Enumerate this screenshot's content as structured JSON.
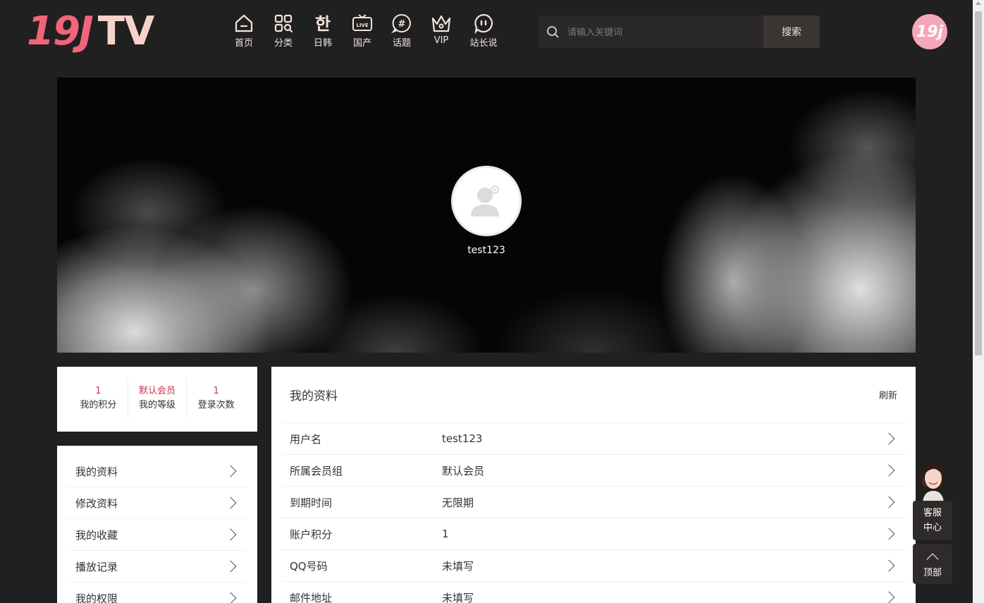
{
  "header": {
    "logo_part1": "19J",
    "logo_part2": "TV",
    "nav": [
      {
        "label": "首页",
        "icon": "home-icon"
      },
      {
        "label": "分类",
        "icon": "category-icon"
      },
      {
        "label": "日韩",
        "icon": "korean-char-icon",
        "glyph": "한"
      },
      {
        "label": "国产",
        "icon": "live-tv-icon",
        "glyph": "LIVE"
      },
      {
        "label": "话题",
        "icon": "hashtag-icon",
        "glyph": "#"
      },
      {
        "label": "VIP",
        "icon": "crown-icon"
      },
      {
        "label": "站长说",
        "icon": "chat-bubble-icon"
      }
    ],
    "search": {
      "placeholder": "请输入关键词",
      "button": "搜索"
    },
    "user_avatar_text": "19j"
  },
  "banner": {
    "username": "test123"
  },
  "stats": [
    {
      "value": "1",
      "label": "我的积分"
    },
    {
      "value": "默认会员",
      "label": "我的等级"
    },
    {
      "value": "1",
      "label": "登录次数"
    }
  ],
  "side_menu": [
    "我的资料",
    "修改资料",
    "我的收藏",
    "播放记录",
    "我的权限"
  ],
  "profile": {
    "title": "我的资料",
    "refresh": "刷新",
    "rows": [
      {
        "label": "用户名",
        "value": "test123"
      },
      {
        "label": "所属会员组",
        "value": "默认会员"
      },
      {
        "label": "到期时间",
        "value": "无限期"
      },
      {
        "label": "账户积分",
        "value": "1"
      },
      {
        "label": "QQ号码",
        "value": "未填写"
      },
      {
        "label": "邮件地址",
        "value": "未填写"
      }
    ]
  },
  "float": {
    "service_line1": "客服",
    "service_line2": "中心",
    "top": "顶部"
  },
  "colors": {
    "accent_pink": "#f2647a",
    "logo_cream": "#f6d3c8",
    "stat_red": "#d0304a",
    "background": "#202020"
  }
}
